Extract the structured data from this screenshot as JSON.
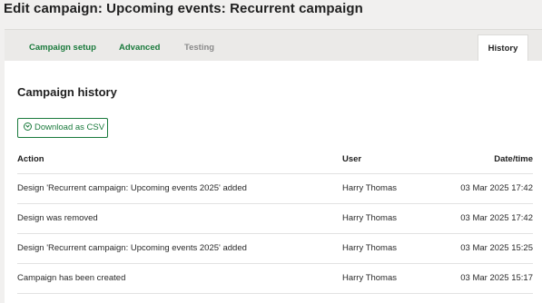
{
  "page": {
    "title": "Edit campaign: Upcoming events: Recurrent campaign"
  },
  "tabs": [
    {
      "label": "Campaign setup"
    },
    {
      "label": "Advanced"
    },
    {
      "label": "Testing"
    },
    {
      "label": "History"
    }
  ],
  "main": {
    "section_title": "Campaign history",
    "download_label": "Download as CSV",
    "download_icon": "download-circle-icon"
  },
  "table": {
    "headers": {
      "action": "Action",
      "user": "User",
      "datetime": "Date/time"
    },
    "rows": [
      {
        "action": "Design 'Recurrent campaign: Upcoming events 2025' added",
        "user": "Harry Thomas",
        "datetime": "03 Mar 2025 17:42"
      },
      {
        "action": "Design was removed",
        "user": "Harry Thomas",
        "datetime": "03 Mar 2025 17:42"
      },
      {
        "action": "Design 'Recurrent campaign: Upcoming events 2025' added",
        "user": "Harry Thomas",
        "datetime": "03 Mar 2025 15:25"
      },
      {
        "action": "Campaign has been created",
        "user": "Harry Thomas",
        "datetime": "03 Mar 2025 15:17"
      }
    ]
  },
  "colors": {
    "accent": "#1a7a3c",
    "background": "#f1f0ef"
  }
}
